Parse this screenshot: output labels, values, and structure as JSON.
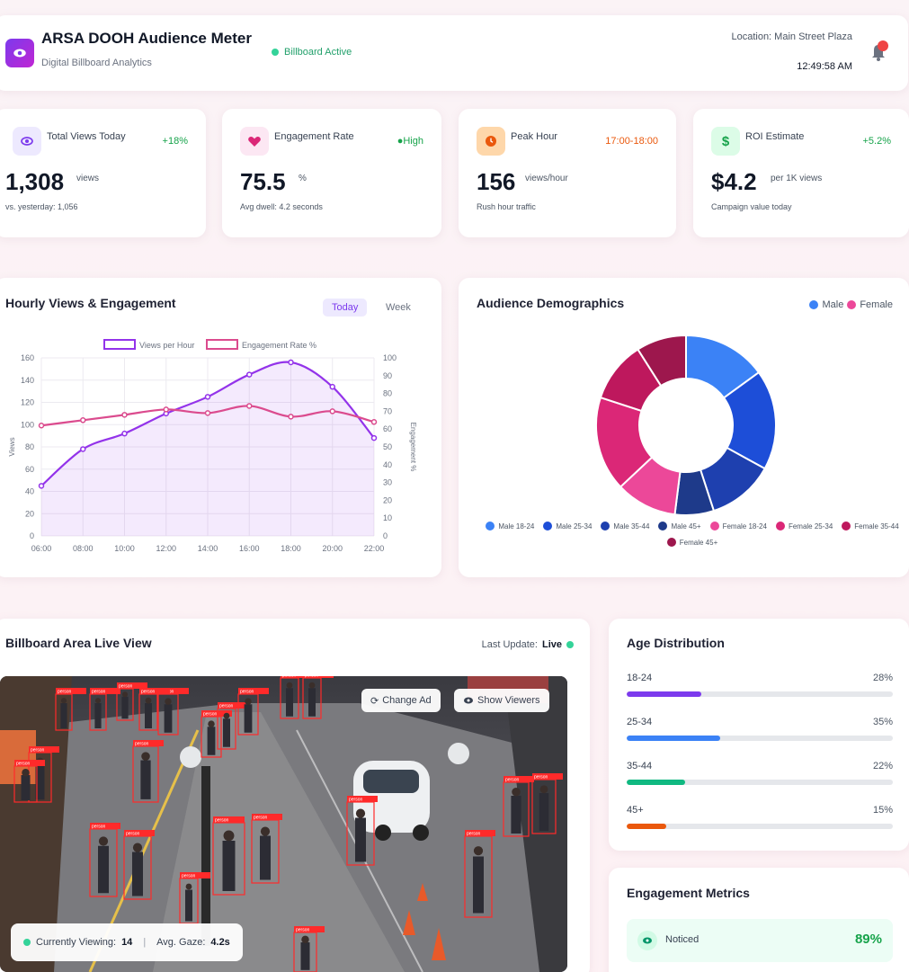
{
  "header": {
    "title": "ARSA DOOH Audience Meter",
    "subtitle": "Digital Billboard Analytics",
    "status": "Billboard Active",
    "location": "Location: Main Street Plaza",
    "time": "12:49:58 AM"
  },
  "stats": [
    {
      "label": "Total Views Today",
      "change": "+18%",
      "value": "1,308",
      "unit": "views",
      "sub": "vs. yesterday: 1,056",
      "icon": "eye-icon",
      "color": "#7c3aed"
    },
    {
      "label": "Engagement Rate",
      "change": "●High",
      "value": "75.5",
      "unit": "%",
      "sub": "Avg dwell: 4.2 seconds",
      "icon": "heart-icon",
      "color": "#db2777"
    },
    {
      "label": "Peak Hour",
      "change": "17:00-18:00",
      "value": "156",
      "unit": "views/hour",
      "sub": "Rush hour traffic",
      "icon": "clock-icon",
      "color": "#ea580c"
    },
    {
      "label": "ROI Estimate",
      "change": "+5.2%",
      "value": "$4.2",
      "unit": "per 1K views",
      "sub": "Campaign value today",
      "icon": "dollar-icon",
      "color": "#16a34a"
    }
  ],
  "hourly": {
    "title": "Hourly Views & Engagement",
    "tabs": [
      "Today",
      "Week"
    ],
    "active_tab": "Today"
  },
  "demographics": {
    "title": "Audience Demographics",
    "legend_top": [
      "Male",
      "Female"
    ]
  },
  "chart_data": [
    {
      "type": "line",
      "x": [
        "06:00",
        "08:00",
        "10:00",
        "12:00",
        "14:00",
        "16:00",
        "18:00",
        "20:00",
        "22:00"
      ],
      "series": [
        {
          "name": "Views per Hour",
          "axis": "left",
          "color": "#9333ea",
          "values": [
            45,
            78,
            92,
            110,
            125,
            145,
            156,
            134,
            88
          ]
        },
        {
          "name": "Engagement Rate %",
          "axis": "right",
          "color": "#db4b8e",
          "values": [
            62,
            65,
            68,
            71,
            69,
            73,
            67,
            70,
            64
          ]
        }
      ],
      "ylabel": "Views",
      "y2label": "Engagement %",
      "ylim": [
        0,
        160
      ],
      "y2lim": [
        0,
        100
      ],
      "yticks": [
        "0",
        "20",
        "40",
        "60",
        "80",
        "100",
        "120",
        "140",
        "160"
      ],
      "y2ticks": [
        "0",
        "10",
        "20",
        "30",
        "40",
        "50",
        "60",
        "70",
        "80",
        "90",
        "100"
      ],
      "grid": true,
      "legend": "top"
    },
    {
      "type": "pie",
      "donut": true,
      "categories": [
        "Male 18-24",
        "Male 25-34",
        "Male 35-44",
        "Male 45+",
        "Female 18-24",
        "Female 25-34",
        "Female 35-44",
        "Female 45+"
      ],
      "values": [
        15,
        18,
        12,
        7,
        11,
        17,
        11,
        9
      ],
      "colors": [
        "#3b82f6",
        "#1d4ed8",
        "#1e40af",
        "#1e3a8a",
        "#ec4899",
        "#db2777",
        "#be185d",
        "#9d174d"
      ],
      "legend": "bottom"
    }
  ],
  "live": {
    "title": "Billboard Area Live View",
    "update_label": "Last Update:",
    "update_value": "Live",
    "change_ad": "Change Ad",
    "show_viewers": "Show Viewers",
    "viewing_label": "Currently Viewing:",
    "viewing_value": "14",
    "gaze_label": "Avg. Gaze:",
    "gaze_value": "4.2s",
    "detection_label": "person"
  },
  "age": {
    "title": "Age Distribution",
    "rows": [
      {
        "label": "18-24",
        "pct": "28%",
        "value": 28,
        "color": "#7c3aed"
      },
      {
        "label": "25-34",
        "pct": "35%",
        "value": 35,
        "color": "#3b82f6"
      },
      {
        "label": "35-44",
        "pct": "22%",
        "value": 22,
        "color": "#10b981"
      },
      {
        "label": "45+",
        "pct": "15%",
        "value": 15,
        "color": "#ea580c"
      }
    ]
  },
  "engagement": {
    "title": "Engagement Metrics",
    "items": [
      {
        "label": "Noticed",
        "value": "89%"
      }
    ]
  }
}
